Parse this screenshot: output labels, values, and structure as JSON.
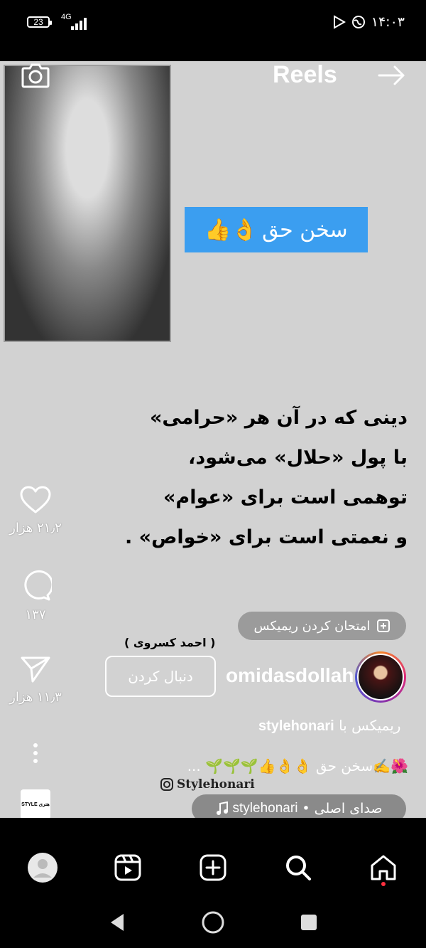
{
  "status_bar": {
    "battery": "23",
    "network": "4G",
    "time": "۱۴:۰۳"
  },
  "header": {
    "title": "Reels"
  },
  "video": {
    "title_box": {
      "text": "سخن حق",
      "emoji": "👌👍"
    },
    "quote_lines": [
      "دینی که در آن هر «حرامی»",
      "با پول «حلال» می‌شود،",
      "توهمی است برای «عوام»",
      "و نعمتی است برای «خواص» ."
    ],
    "author_caption": "( احمد کسروی )",
    "watermark": "Stylehonari"
  },
  "actions": {
    "likes": "۲۱٫۲ هزار",
    "comments": "۱۳۷",
    "shares": "۱۱٫۳ هزار"
  },
  "remix_button": {
    "label": "امتحان کردن ریمیکس"
  },
  "author": {
    "username": "omidasdollah",
    "follow_label": "دنبال کردن"
  },
  "remix_with": {
    "prefix": "ریمیکس با",
    "user": "stylehonari"
  },
  "caption": "🌺✍️سخن حق 👌👌👍🌱🌱🌱 ...",
  "audio": {
    "user": "stylehonari",
    "separator": "•",
    "label": "صدای اصلی"
  },
  "style_thumb_text": "STYLE هنری",
  "colors": {
    "video_bg": "#d2d2d2",
    "title_box": "#3b9ef0",
    "notification_dot": "#ff3040"
  },
  "tabs": [
    "home-icon",
    "search-icon",
    "create-icon",
    "reels-icon",
    "profile-icon"
  ]
}
